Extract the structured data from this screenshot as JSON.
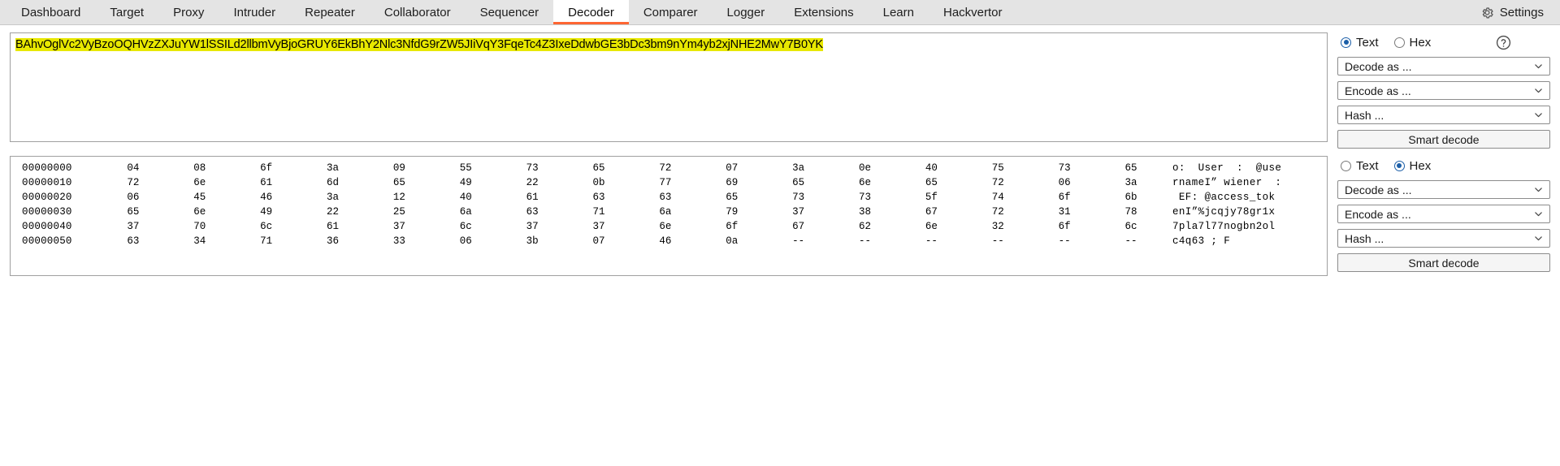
{
  "nav": {
    "tabs": [
      {
        "label": "Dashboard",
        "active": false
      },
      {
        "label": "Target",
        "active": false
      },
      {
        "label": "Proxy",
        "active": false
      },
      {
        "label": "Intruder",
        "active": false
      },
      {
        "label": "Repeater",
        "active": false
      },
      {
        "label": "Collaborator",
        "active": false
      },
      {
        "label": "Sequencer",
        "active": false
      },
      {
        "label": "Decoder",
        "active": true
      },
      {
        "label": "Comparer",
        "active": false
      },
      {
        "label": "Logger",
        "active": false
      },
      {
        "label": "Extensions",
        "active": false
      },
      {
        "label": "Learn",
        "active": false
      },
      {
        "label": "Hackvertor",
        "active": false
      }
    ],
    "settings_label": "Settings",
    "settings_icon": "gear-icon",
    "active_tab_accent": "#ff6633",
    "bar_background": "#e4e4e4"
  },
  "top_panel": {
    "input_text": "BAhvOglVc2VyBzoOQHVzZXJuYW1lSSILd2llbmVyBjoGRUY6EkBhY2Nlc3NfdG9rZW5JIiVqY3FqeTc4Z3IxeDdwbGE3bDc3bm9nYm4yb2xjNHE2MwY7B0YK",
    "highlight_color": "#e8e800",
    "controls": {
      "text_label": "Text",
      "hex_label": "Hex",
      "selected_mode": "Text",
      "help_icon": "question-mark-icon",
      "decode_as": "Decode as ...",
      "encode_as": "Encode as ...",
      "hash_as": "Hash ...",
      "smart_decode": "Smart decode"
    }
  },
  "bottom_panel": {
    "controls": {
      "text_label": "Text",
      "hex_label": "Hex",
      "selected_mode": "Hex",
      "decode_as": "Decode as ...",
      "encode_as": "Encode as ...",
      "hash_as": "Hash ...",
      "smart_decode": "Smart decode"
    },
    "hex_rows": [
      {
        "offset": "00000000",
        "bytes": [
          "04",
          "08",
          "6f",
          "3a",
          "09",
          "55",
          "73",
          "65",
          "72",
          "07",
          "3a",
          "0e",
          "40",
          "75",
          "73",
          "65"
        ],
        "ascii": "o:  User  :  @use"
      },
      {
        "offset": "00000010",
        "bytes": [
          "72",
          "6e",
          "61",
          "6d",
          "65",
          "49",
          "22",
          "0b",
          "77",
          "69",
          "65",
          "6e",
          "65",
          "72",
          "06",
          "3a"
        ],
        "ascii": "rnameI” wiener  :"
      },
      {
        "offset": "00000020",
        "bytes": [
          "06",
          "45",
          "46",
          "3a",
          "12",
          "40",
          "61",
          "63",
          "63",
          "65",
          "73",
          "73",
          "5f",
          "74",
          "6f",
          "6b"
        ],
        "ascii": " EF: @access_tok"
      },
      {
        "offset": "00000030",
        "bytes": [
          "65",
          "6e",
          "49",
          "22",
          "25",
          "6a",
          "63",
          "71",
          "6a",
          "79",
          "37",
          "38",
          "67",
          "72",
          "31",
          "78"
        ],
        "ascii": "enI”%jcqjy78gr1x"
      },
      {
        "offset": "00000040",
        "bytes": [
          "37",
          "70",
          "6c",
          "61",
          "37",
          "6c",
          "37",
          "37",
          "6e",
          "6f",
          "67",
          "62",
          "6e",
          "32",
          "6f",
          "6c"
        ],
        "ascii": "7pla7l77nogbn2ol"
      },
      {
        "offset": "00000050",
        "bytes": [
          "63",
          "34",
          "71",
          "36",
          "33",
          "06",
          "3b",
          "07",
          "46",
          "0a",
          "--",
          "--",
          "--",
          "--",
          "--",
          "--"
        ],
        "ascii": "c4q63 ; F"
      }
    ]
  }
}
